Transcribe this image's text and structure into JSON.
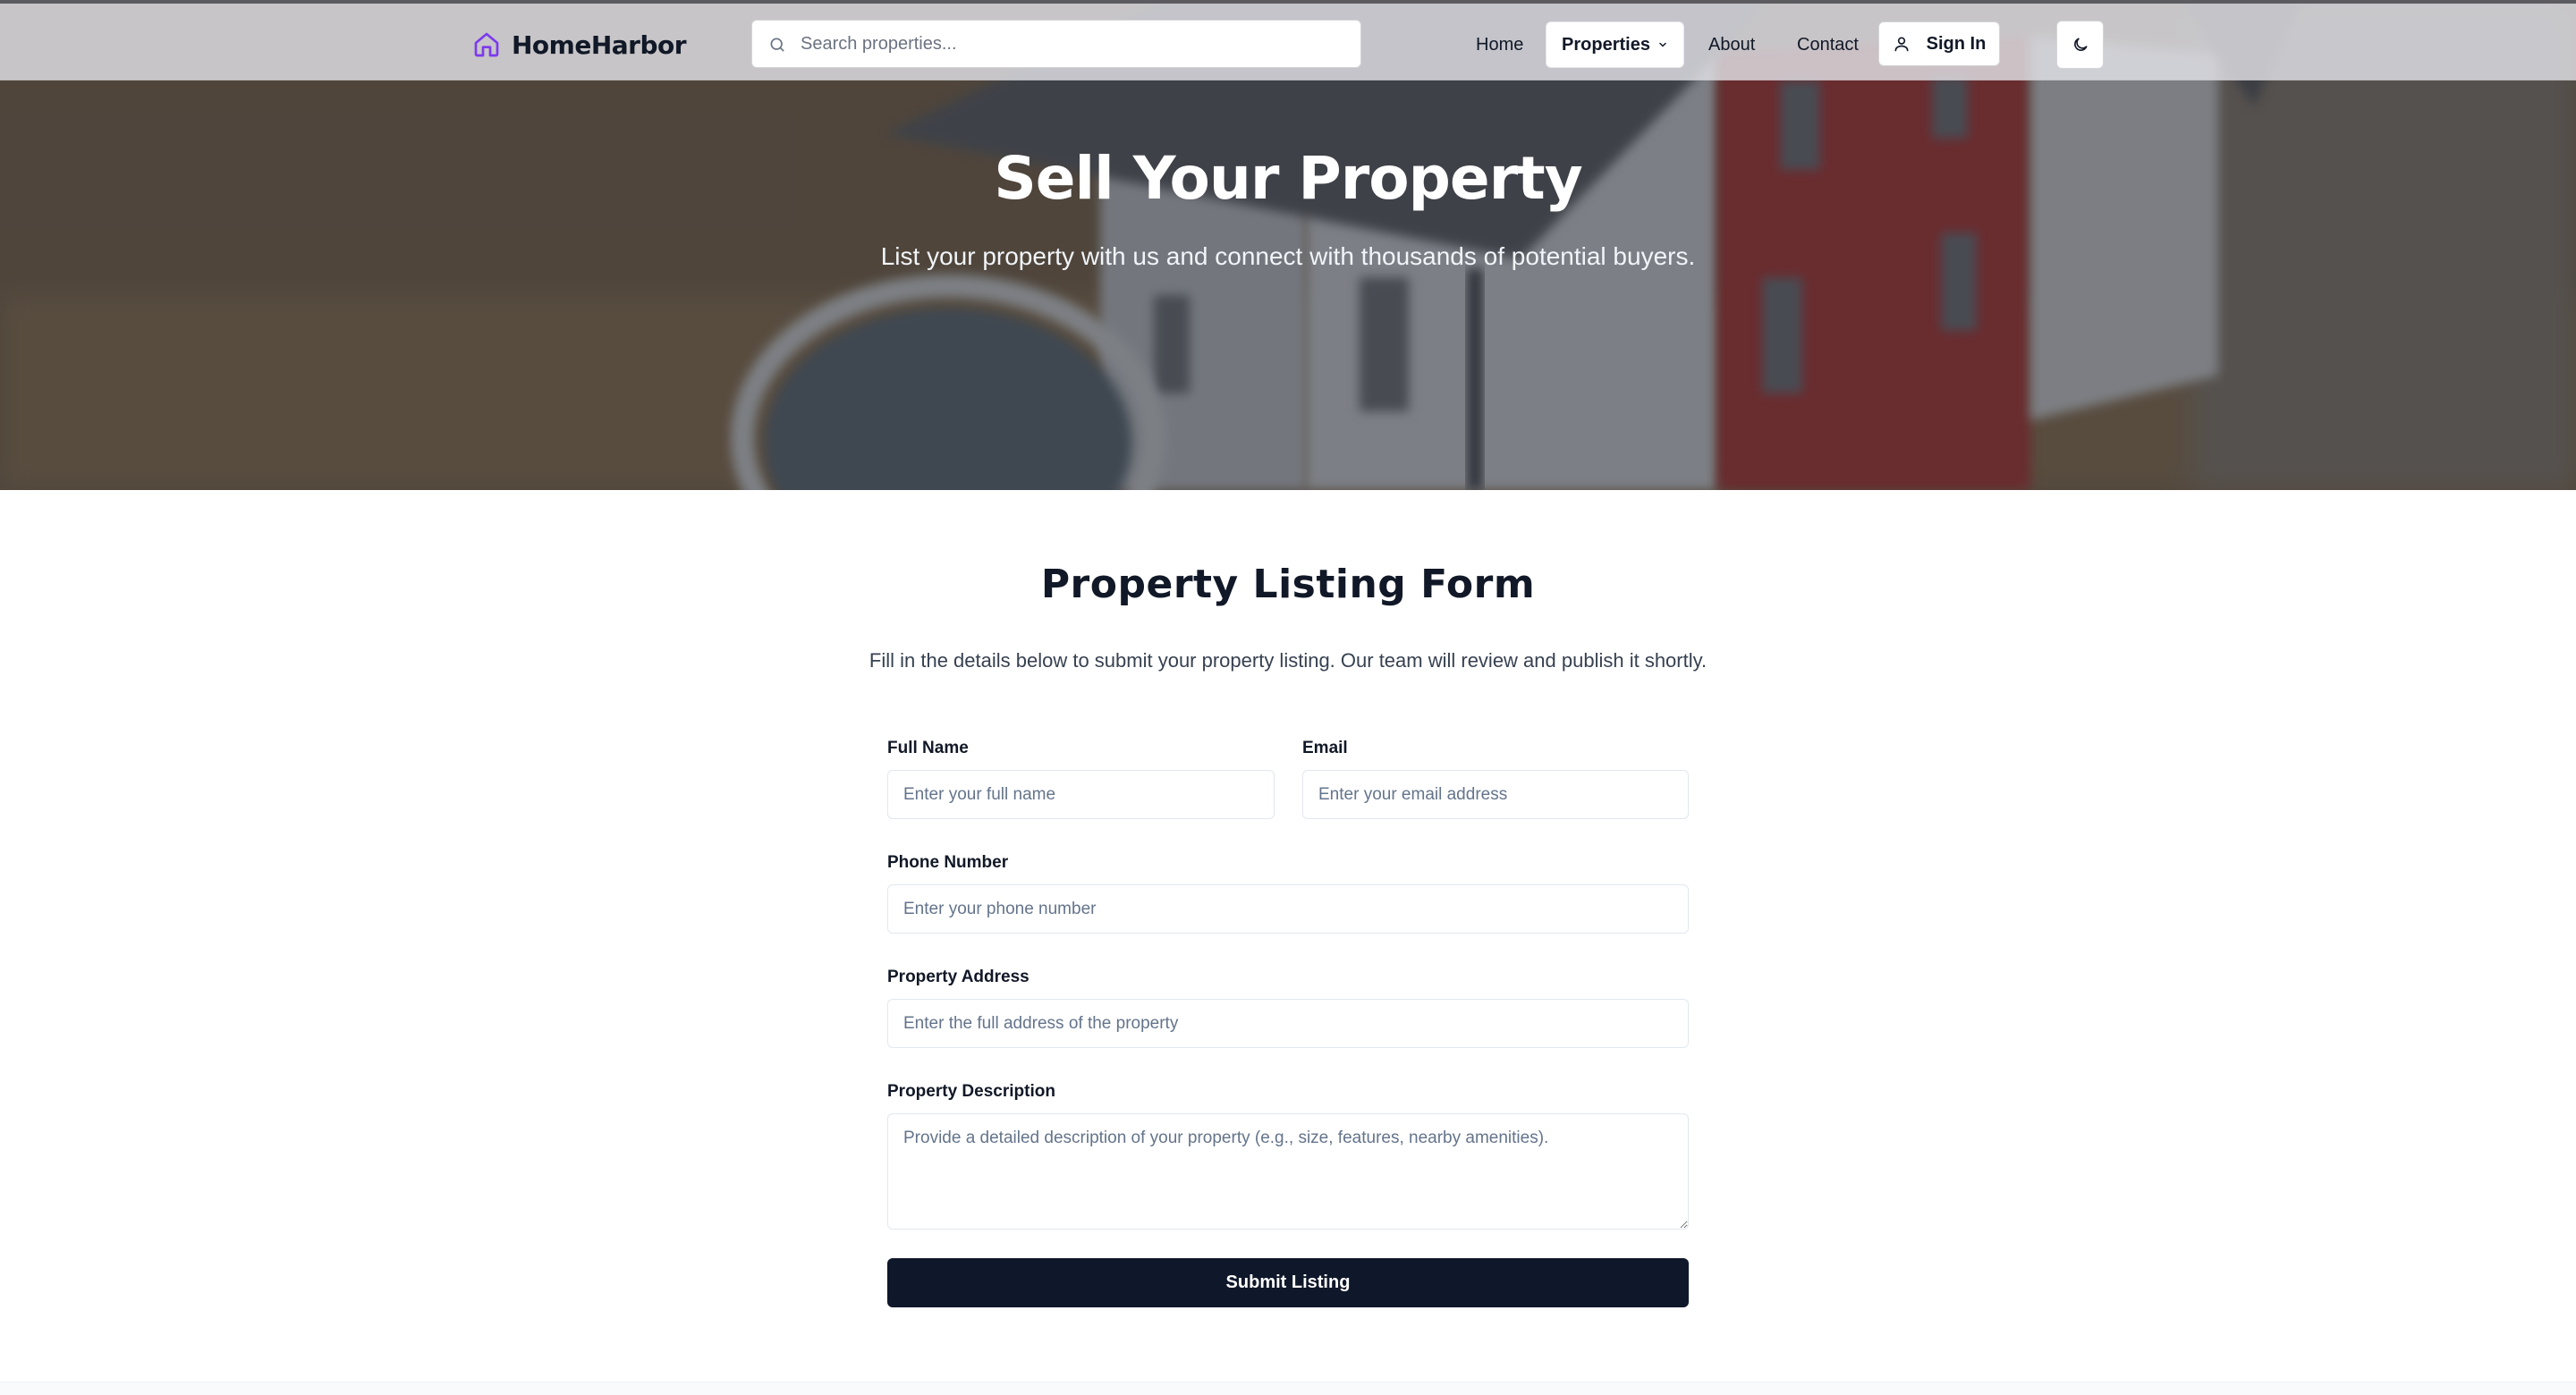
{
  "brand": {
    "name": "HomeHarbor"
  },
  "search": {
    "placeholder": "Search properties..."
  },
  "nav": {
    "home": "Home",
    "properties": "Properties",
    "about": "About",
    "contact": "Contact",
    "sign_in": "Sign In"
  },
  "hero": {
    "title": "Sell Your Property",
    "subtitle": "List your property with us and connect with thousands of potential buyers."
  },
  "form": {
    "title": "Property Listing Form",
    "intro": "Fill in the details below to submit your property listing. Our team will review and publish it shortly.",
    "full_name": {
      "label": "Full Name",
      "placeholder": "Enter your full name"
    },
    "email": {
      "label": "Email",
      "placeholder": "Enter your email address"
    },
    "phone": {
      "label": "Phone Number",
      "placeholder": "Enter your phone number"
    },
    "address": {
      "label": "Property Address",
      "placeholder": "Enter the full address of the property"
    },
    "description": {
      "label": "Property Description",
      "placeholder": "Provide a detailed description of your property (e.g., size, features, nearby amenities)."
    },
    "submit_label": "Submit Listing"
  },
  "colors": {
    "brand_accent": "#7c3aed",
    "primary_button": "#0f172a"
  },
  "icons": [
    "home-icon",
    "search-icon",
    "chevron-down-icon",
    "user-icon",
    "moon-icon",
    "textarea-resize-handle"
  ]
}
